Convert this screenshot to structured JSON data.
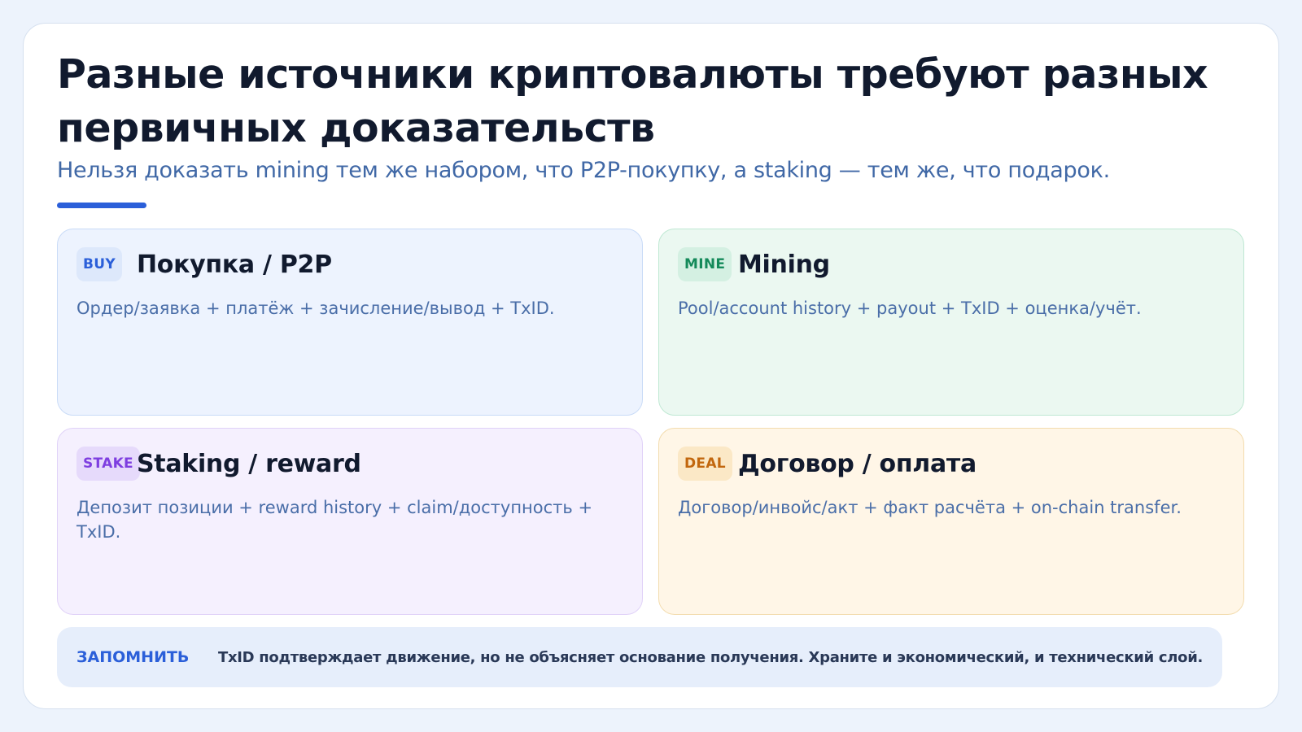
{
  "header": {
    "title": "Разные источники криптовалюты требуют разных первичных доказательств",
    "subtitle": "Нельзя доказать mining тем же набором, что P2P-покупку, а staking — тем же, что подарок."
  },
  "cards": [
    {
      "badge": "BUY",
      "title": "Покупка / P2P",
      "text": "Ордер/заявка + платёж + зачисление/вывод + TxID."
    },
    {
      "badge": "MINE",
      "title": "Mining",
      "text": "Pool/account history + payout + TxID + оценка/учёт."
    },
    {
      "badge": "STAKE",
      "title": "Staking / reward",
      "text": "Депозит позиции + reward history + claim/доступность + TxID."
    },
    {
      "badge": "DEAL",
      "title": "Договор / оплата",
      "text": "Договор/инвойс/акт + факт расчёта + on-chain transfer."
    }
  ],
  "remember": {
    "label": "ЗАПОМНИТЬ",
    "text": "TxID подтверждает движение, но не объясняет основание получения. Храните и экономический, и технический слой."
  },
  "colors": {
    "accent": "#2b5fd9",
    "buy": "#2b5fd9",
    "mine": "#148a5a",
    "stake": "#7e3ee0",
    "deal": "#c2670e"
  }
}
